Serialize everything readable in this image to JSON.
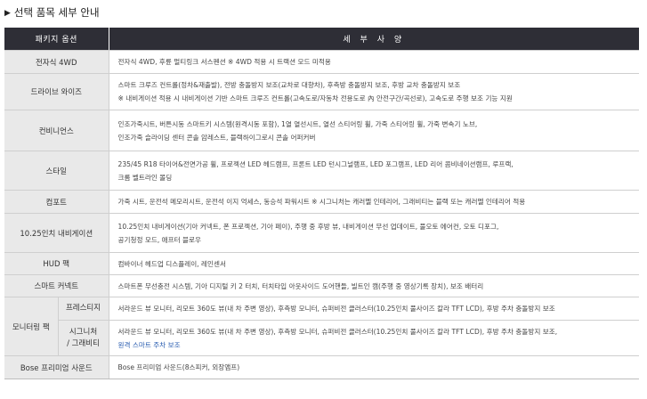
{
  "section_title": "선택 품목 세부 안내",
  "header": {
    "package": "패키지 옵션",
    "details": "세 부 사 양"
  },
  "rows": [
    {
      "name": "전자식 4WD",
      "lines": [
        "전자식 4WD, 후륜 멀티링크 서스펜션  ※ 4WD 적용 시 트랙션 모드 미적용"
      ]
    },
    {
      "name": "드라이브 와이즈",
      "lines": [
        "스마트 크루즈 컨트롤(정차&재출발), 전방 충돌방지 보조(교차로 대향차), 후측방 충돌방지 보조, 후방 교차 충돌방지 보조",
        "※ 내비게이션 적용 시 내비게이션 기반 스마트 크루즈 컨트롤(고속도로/자동차 전용도로 內 안전구간/곡선로), 고속도로 주행 보조 기능 지원"
      ]
    },
    {
      "name": "컨비니언스",
      "lines": [
        "인조가죽시트, 버튼시동 스마트키 시스템(원격시동 포함), 1열 열선시트, 열선 스티어링 휠, 가죽 스티어링 휠, 가죽 변속기 노브,",
        "인조가죽 슬라이딩 센터 콘솔 암레스트, 블랙하이그로시 콘솔 어퍼커버"
      ]
    },
    {
      "name": "스타일",
      "lines": [
        "235/45 R18 타이어&전면가공 휠, 프로젝션 LED 헤드램프, 프론트 LED 턴시그널램프, LED 포그램프, LED 리어 콤비네이션램프, 루프랙,",
        "크롬 벨트라인 몰딩"
      ]
    },
    {
      "name": "컴포트",
      "lines": [
        "가죽 시트, 운전석 메모리시트, 운전석 이지 억세스, 동승석 파워시트  ※ 시그니처는 캐러멜 인테리어, 그래비티는 블랙 또는 캐러멜 인테리어 적용"
      ]
    },
    {
      "name": "10.25인치 내비게이션",
      "lines": [
        "10.25인치 내비게이션(기아 커넥트, 폰 프로젝션, 기아 페이), 주행 중 후방 뷰, 내비게이션 무선 업데이트, 풀오토 에어컨, 오토 디포그,",
        "공기청정 모드, 애프터 블로우"
      ]
    },
    {
      "name": "HUD 팩",
      "lines": [
        "컴바이너 헤드업 디스플레이, 레인센서"
      ]
    },
    {
      "name": "스마트 커넥트",
      "lines": [
        "스마트폰 무선충전 시스템, 기아 디지털 키 2 터치, 터치타입 아웃사이드 도어핸들, 빌트인 캠(주행 중 영상기록 장치), 보조 배터리"
      ]
    }
  ],
  "monitoring": {
    "name": "모니터링 팩",
    "sub": [
      {
        "name": "프레스티지",
        "lines": [
          "서라운드 뷰 모니터, 리모트 360도 뷰(내 차 주변 영상), 후측방 모니터, 슈퍼비전 클러스터(10.25인치 풀사이즈 칼라 TFT LCD), 후방 주차 충돌방지 보조"
        ]
      },
      {
        "name_line1": "시그니처",
        "name_line2": "/ 그래비티",
        "lines": [
          "서라운드 뷰 모니터, 리모트 360도 뷰(내 차 주변 영상), 후측방 모니터, 슈퍼비전 클러스터(10.25인치 풀사이즈 칼라 TFT LCD), 후방 주차 충돌방지 보조,"
        ],
        "link": "원격 스마트 주차 보조"
      }
    ]
  },
  "bose": {
    "name": "Bose 프리미엄 사운드",
    "lines": [
      "Bose 프리미엄 사운드(8스피커, 외장앰프)"
    ]
  }
}
